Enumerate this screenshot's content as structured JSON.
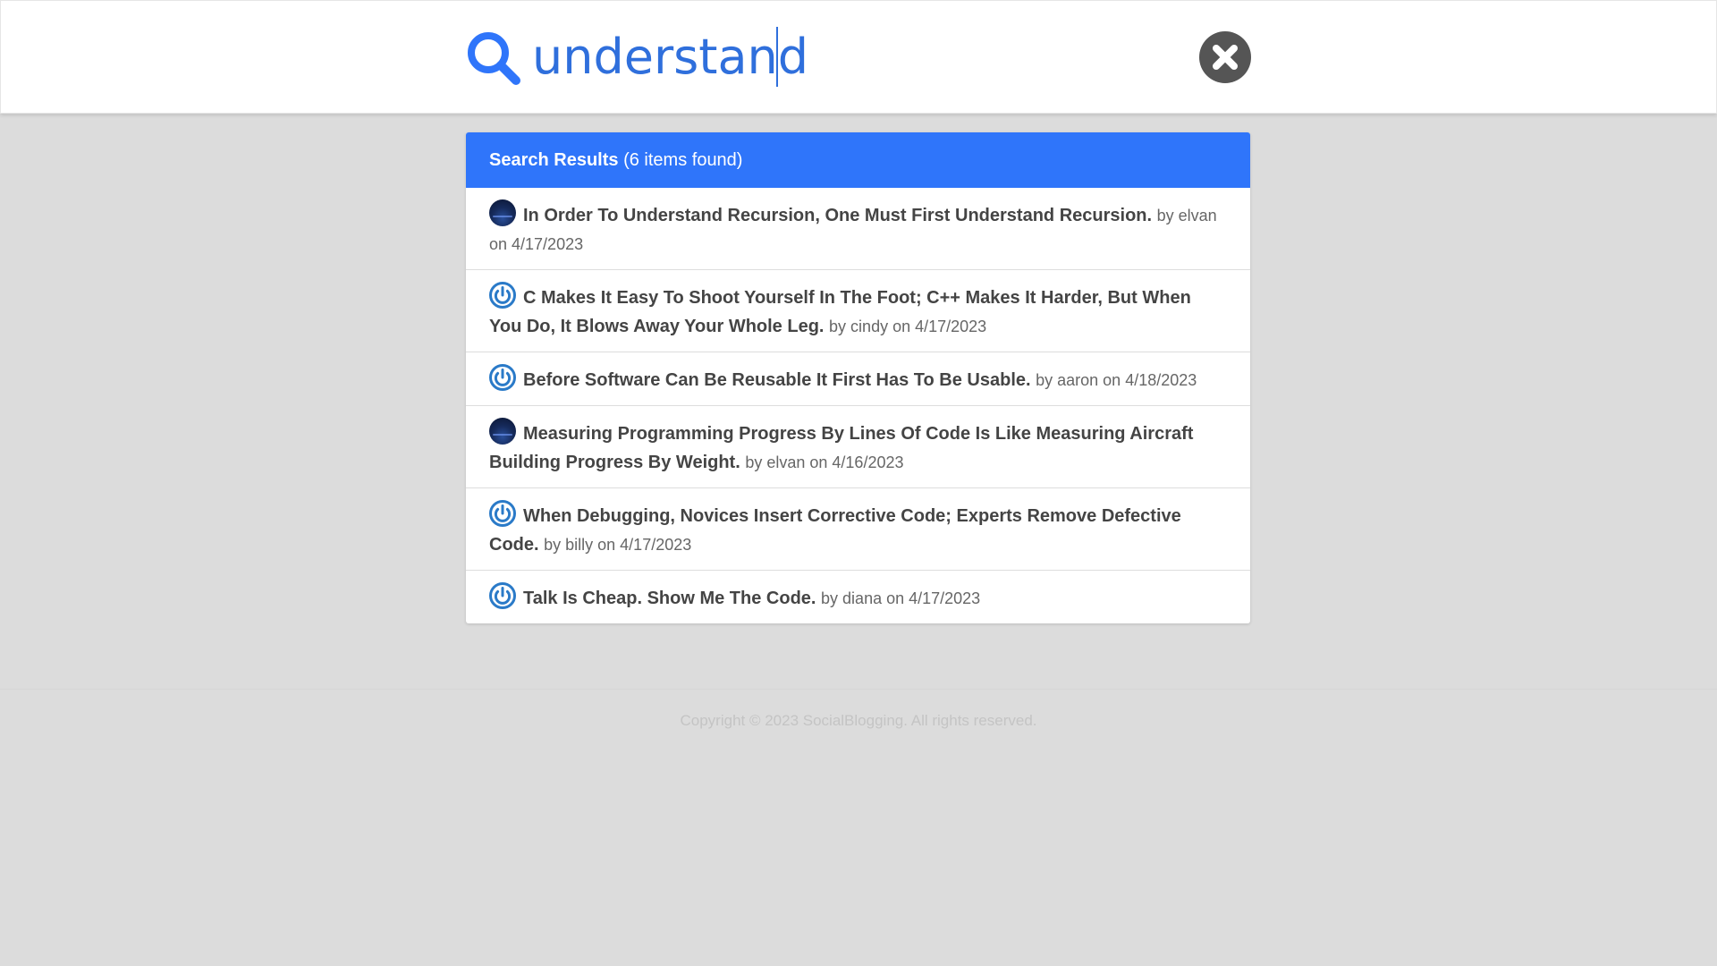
{
  "search": {
    "query": "understand",
    "icon": "search-icon",
    "close_icon": "close-icon",
    "accent_color": "#2f6fdc"
  },
  "results": {
    "header_title": "Search Results",
    "header_count": "(6 items found)",
    "header_color": "#2f75fa",
    "items": [
      {
        "title": "In Order To Understand Recursion, One Must First Understand Recursion.",
        "meta": "by elvan on 4/17/2023",
        "avatar": "photo-avatar"
      },
      {
        "title": "C Makes It Easy To Shoot Yourself In The Foot; C++ Makes It Harder, But When You Do, It Blows Away Your Whole Leg.",
        "meta": "by cindy on 4/17/2023",
        "avatar": "power-icon"
      },
      {
        "title": "Before Software Can Be Reusable It First Has To Be Usable.",
        "meta": "by aaron on 4/18/2023",
        "avatar": "power-icon"
      },
      {
        "title": "Measuring Programming Progress By Lines Of Code Is Like Measuring Aircraft Building Progress By Weight.",
        "meta": "by elvan on 4/16/2023",
        "avatar": "photo-avatar"
      },
      {
        "title": "When Debugging, Novices Insert Corrective Code; Experts Remove Defective Code.",
        "meta": "by billy on 4/17/2023",
        "avatar": "power-icon"
      },
      {
        "title": "Talk Is Cheap. Show Me The Code.",
        "meta": "by diana on 4/17/2023",
        "avatar": "power-icon"
      }
    ]
  },
  "footer": {
    "copyright": "Copyright © 2023 SocialBlogging. All rights reserved."
  }
}
